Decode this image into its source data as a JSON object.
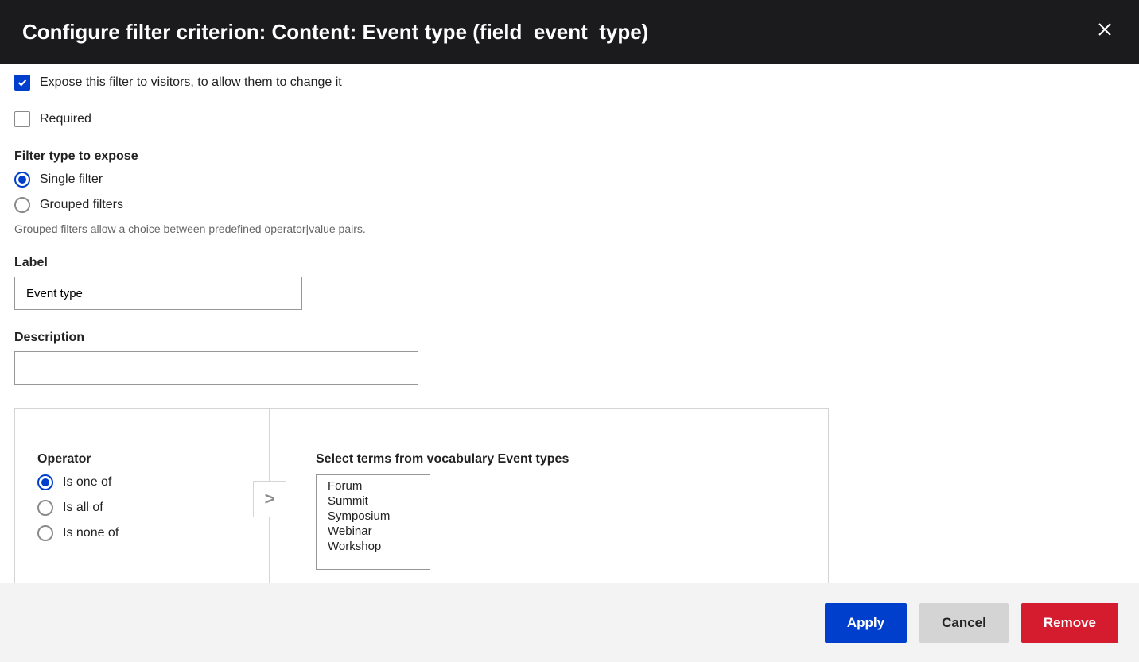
{
  "dialog": {
    "title": "Configure filter criterion: Content: Event type (field_event_type)"
  },
  "expose": {
    "checkbox_label": "Expose this filter to visitors, to allow them to change it",
    "checked": true
  },
  "required": {
    "checkbox_label": "Required",
    "checked": false
  },
  "filter_type": {
    "heading": "Filter type to expose",
    "options": {
      "single": "Single filter",
      "grouped": "Grouped filters"
    },
    "selected": "single",
    "help": "Grouped filters allow a choice between predefined operator|value pairs."
  },
  "label_field": {
    "label": "Label",
    "value": "Event type"
  },
  "description_field": {
    "label": "Description",
    "value": ""
  },
  "operator": {
    "heading": "Operator",
    "options": {
      "one_of": "Is one of",
      "all_of": "Is all of",
      "none_of": "Is none of"
    },
    "selected": "one_of"
  },
  "terms": {
    "heading": "Select terms from vocabulary Event types",
    "options": [
      "Forum",
      "Summit",
      "Symposium",
      "Webinar",
      "Workshop"
    ]
  },
  "toggle_caret": ">",
  "buttons": {
    "apply": "Apply",
    "cancel": "Cancel",
    "remove": "Remove"
  }
}
